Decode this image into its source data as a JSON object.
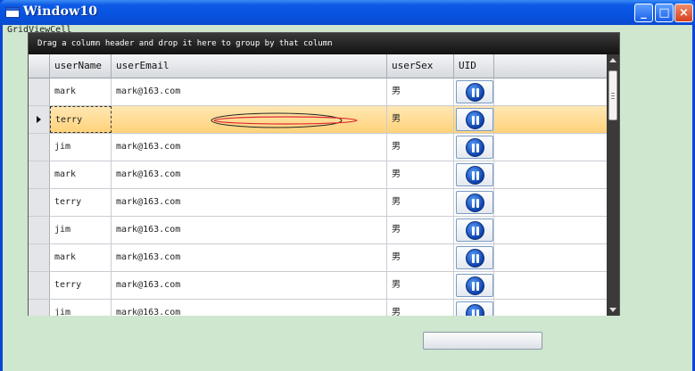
{
  "window": {
    "title": "Window10"
  },
  "label": "GridViewCell",
  "grid": {
    "group_panel_text": "Drag a column header and drop it here to group by that column",
    "columns": [
      "userName",
      "userEmail",
      "userSex",
      "UID"
    ],
    "rows": [
      {
        "userName": "mark",
        "userEmail": "mark@163.com",
        "userSex": "男",
        "selected": false
      },
      {
        "userName": "terry",
        "userEmail": "",
        "userSex": "男",
        "selected": true
      },
      {
        "userName": "jim",
        "userEmail": "mark@163.com",
        "userSex": "男",
        "selected": false
      },
      {
        "userName": "mark",
        "userEmail": "mark@163.com",
        "userSex": "男",
        "selected": false
      },
      {
        "userName": "terry",
        "userEmail": "mark@163.com",
        "userSex": "男",
        "selected": false
      },
      {
        "userName": "jim",
        "userEmail": "mark@163.com",
        "userSex": "男",
        "selected": false
      },
      {
        "userName": "mark",
        "userEmail": "mark@163.com",
        "userSex": "男",
        "selected": false
      },
      {
        "userName": "terry",
        "userEmail": "mark@163.com",
        "userSex": "男",
        "selected": false
      },
      {
        "userName": "jim",
        "userEmail": "mark@163.com",
        "userSex": "男",
        "selected": false
      }
    ]
  },
  "colors": {
    "selected_row": "#ffd27a",
    "background": "#cfe6cf",
    "title_bar": "#0653e0"
  },
  "icons": {
    "uid_button": "pause-circle-icon"
  }
}
